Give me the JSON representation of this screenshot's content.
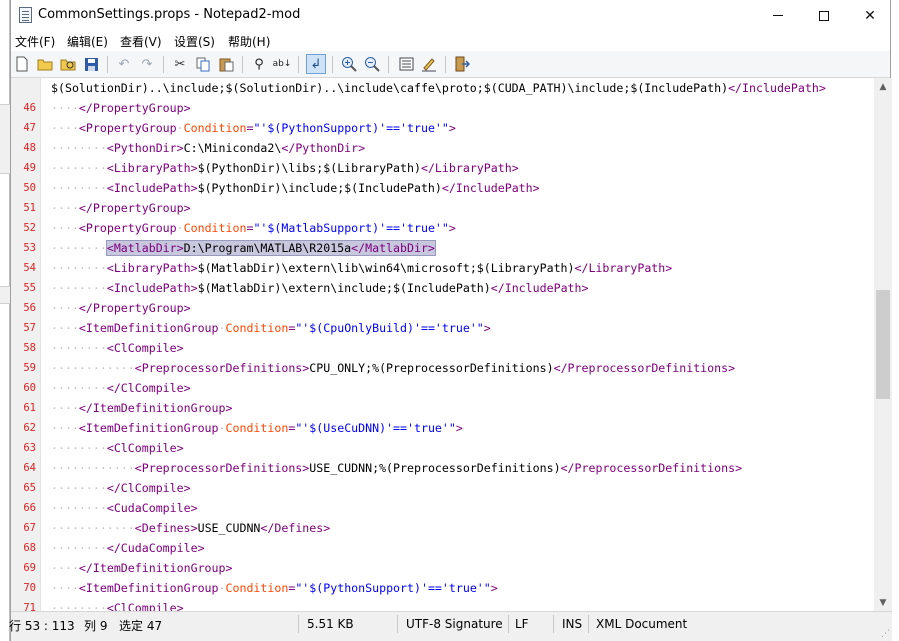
{
  "window": {
    "title": "CommonSettings.props - Notepad2-mod"
  },
  "menu": [
    {
      "label": "文件(F)"
    },
    {
      "label": "编辑(E)"
    },
    {
      "label": "查看(V)"
    },
    {
      "label": "设置(S)"
    },
    {
      "label": "帮助(H)"
    }
  ],
  "toolbar": {
    "buttons": [
      {
        "icon": "new-file-icon"
      },
      {
        "icon": "open-folder-icon"
      },
      {
        "icon": "browse-icon"
      },
      {
        "icon": "save-icon"
      },
      {
        "icon": "undo-icon"
      },
      {
        "icon": "redo-icon"
      },
      {
        "icon": "cut-icon"
      },
      {
        "icon": "copy-icon"
      },
      {
        "icon": "paste-icon"
      },
      {
        "icon": "find-icon"
      },
      {
        "icon": "replace-icon"
      },
      {
        "icon": "word-wrap-icon"
      },
      {
        "icon": "zoom-in-icon"
      },
      {
        "icon": "zoom-out-icon"
      },
      {
        "icon": "scheme-icon"
      },
      {
        "icon": "customize-icon"
      },
      {
        "icon": "exit-icon"
      }
    ]
  },
  "editor": {
    "lines": [
      {
        "num": "",
        "indent": 0,
        "tokens": [
          [
            "txt",
            "$(SolutionDir)..\\include;$(SolutionDir)..\\include\\caffe\\proto;$(CUDA_PATH)\\include;$(IncludePath)"
          ],
          [
            "tag",
            "</IncludePath>"
          ]
        ]
      },
      {
        "num": "46",
        "indent": 2,
        "tokens": [
          [
            "tag",
            "</PropertyGroup>"
          ]
        ]
      },
      {
        "num": "47",
        "indent": 2,
        "tokens": [
          [
            "tag",
            "<PropertyGroup"
          ],
          [
            "ws",
            "·"
          ],
          [
            "attr",
            "Condition"
          ],
          [
            "tag",
            "="
          ],
          [
            "val",
            "\"'$(PythonSupport)'=='true'\""
          ],
          [
            "tag",
            ">"
          ]
        ]
      },
      {
        "num": "48",
        "indent": 4,
        "tokens": [
          [
            "tag",
            "<PythonDir>"
          ],
          [
            "txt",
            "C:\\Miniconda2\\"
          ],
          [
            "tag",
            "</PythonDir>"
          ]
        ]
      },
      {
        "num": "49",
        "indent": 4,
        "tokens": [
          [
            "tag",
            "<LibraryPath>"
          ],
          [
            "txt",
            "$(PythonDir)\\libs;$(LibraryPath)"
          ],
          [
            "tag",
            "</LibraryPath>"
          ]
        ]
      },
      {
        "num": "50",
        "indent": 4,
        "tokens": [
          [
            "tag",
            "<IncludePath>"
          ],
          [
            "txt",
            "$(PythonDir)\\include;$(IncludePath)"
          ],
          [
            "tag",
            "</IncludePath>"
          ]
        ]
      },
      {
        "num": "51",
        "indent": 2,
        "tokens": [
          [
            "tag",
            "</PropertyGroup>"
          ]
        ]
      },
      {
        "num": "52",
        "indent": 2,
        "tokens": [
          [
            "tag",
            "<PropertyGroup"
          ],
          [
            "ws",
            "·"
          ],
          [
            "attr",
            "Condition"
          ],
          [
            "tag",
            "="
          ],
          [
            "val",
            "\"'$(MatlabSupport)'=='true'\""
          ],
          [
            "tag",
            ">"
          ]
        ]
      },
      {
        "num": "53",
        "indent": 4,
        "selected": true,
        "tokens": [
          [
            "tag",
            "<MatlabDir>"
          ],
          [
            "txt",
            "D:\\Program\\MATLAB\\R2015a"
          ],
          [
            "tag",
            "</MatlabDir>"
          ]
        ]
      },
      {
        "num": "54",
        "indent": 4,
        "tokens": [
          [
            "tag",
            "<LibraryPath>"
          ],
          [
            "txt",
            "$(MatlabDir)\\extern\\lib\\win64\\microsoft;$(LibraryPath)"
          ],
          [
            "tag",
            "</LibraryPath>"
          ]
        ]
      },
      {
        "num": "55",
        "indent": 4,
        "tokens": [
          [
            "tag",
            "<IncludePath>"
          ],
          [
            "txt",
            "$(MatlabDir)\\extern\\include;$(IncludePath)"
          ],
          [
            "tag",
            "</IncludePath>"
          ]
        ]
      },
      {
        "num": "56",
        "indent": 2,
        "tokens": [
          [
            "tag",
            "</PropertyGroup>"
          ]
        ]
      },
      {
        "num": "57",
        "indent": 2,
        "tokens": [
          [
            "tag",
            "<ItemDefinitionGroup"
          ],
          [
            "ws",
            "·"
          ],
          [
            "attr",
            "Condition"
          ],
          [
            "tag",
            "="
          ],
          [
            "val",
            "\"'$(CpuOnlyBuild)'=='true'\""
          ],
          [
            "tag",
            ">"
          ]
        ]
      },
      {
        "num": "58",
        "indent": 4,
        "tokens": [
          [
            "tag",
            "<ClCompile>"
          ]
        ]
      },
      {
        "num": "59",
        "indent": 6,
        "tokens": [
          [
            "tag",
            "<PreprocessorDefinitions>"
          ],
          [
            "txt",
            "CPU_ONLY;%(PreprocessorDefinitions)"
          ],
          [
            "tag",
            "</PreprocessorDefinitions>"
          ]
        ]
      },
      {
        "num": "60",
        "indent": 4,
        "tokens": [
          [
            "tag",
            "</ClCompile>"
          ]
        ]
      },
      {
        "num": "61",
        "indent": 2,
        "tokens": [
          [
            "tag",
            "</ItemDefinitionGroup>"
          ]
        ]
      },
      {
        "num": "62",
        "indent": 2,
        "tokens": [
          [
            "tag",
            "<ItemDefinitionGroup"
          ],
          [
            "ws",
            "·"
          ],
          [
            "attr",
            "Condition"
          ],
          [
            "tag",
            "="
          ],
          [
            "val",
            "\"'$(UseCuDNN)'=='true'\""
          ],
          [
            "tag",
            ">"
          ]
        ]
      },
      {
        "num": "63",
        "indent": 4,
        "tokens": [
          [
            "tag",
            "<ClCompile>"
          ]
        ]
      },
      {
        "num": "64",
        "indent": 6,
        "tokens": [
          [
            "tag",
            "<PreprocessorDefinitions>"
          ],
          [
            "txt",
            "USE_CUDNN;%(PreprocessorDefinitions)"
          ],
          [
            "tag",
            "</PreprocessorDefinitions>"
          ]
        ]
      },
      {
        "num": "65",
        "indent": 4,
        "tokens": [
          [
            "tag",
            "</ClCompile>"
          ]
        ]
      },
      {
        "num": "66",
        "indent": 4,
        "tokens": [
          [
            "tag",
            "<CudaCompile>"
          ]
        ]
      },
      {
        "num": "67",
        "indent": 6,
        "tokens": [
          [
            "tag",
            "<Defines>"
          ],
          [
            "txt",
            "USE_CUDNN"
          ],
          [
            "tag",
            "</Defines>"
          ]
        ]
      },
      {
        "num": "68",
        "indent": 4,
        "tokens": [
          [
            "tag",
            "</CudaCompile>"
          ]
        ]
      },
      {
        "num": "69",
        "indent": 2,
        "tokens": [
          [
            "tag",
            "</ItemDefinitionGroup>"
          ]
        ]
      },
      {
        "num": "70",
        "indent": 2,
        "tokens": [
          [
            "tag",
            "<ItemDefinitionGroup"
          ],
          [
            "ws",
            "·"
          ],
          [
            "attr",
            "Condition"
          ],
          [
            "tag",
            "="
          ],
          [
            "val",
            "\"'$(PythonSupport)'=='true'\""
          ],
          [
            "tag",
            ">"
          ]
        ]
      },
      {
        "num": "71",
        "indent": 4,
        "tokens": [
          [
            "tag",
            "<ClCompile>"
          ]
        ]
      }
    ]
  },
  "status": {
    "position": "行 53 : 113",
    "column": "列 9",
    "selection": "选定 47",
    "size": "5.51 KB",
    "encoding": "UTF-8 Signature",
    "eol": "LF",
    "insert_mode": "INS",
    "doc_type": "XML Document"
  },
  "colors": {
    "tag": "#800080",
    "attribute": "#ff4500",
    "value": "#0000ff",
    "text": "#000000",
    "line_number": "#dd2222",
    "whitespace": "#c2c2c2",
    "selection": "#c7c7de"
  }
}
